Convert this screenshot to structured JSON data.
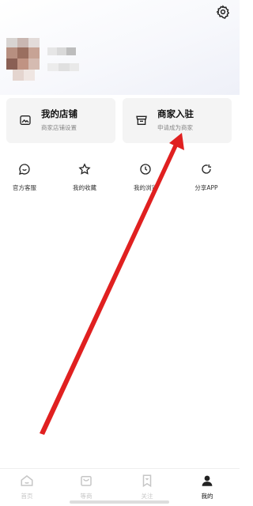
{
  "header": {
    "settings_icon": "gear-icon"
  },
  "profile": {
    "avatar_icon": "blurred-avatar",
    "name_icon": "blurred-username"
  },
  "cards": [
    {
      "title": "我的店铺",
      "subtitle": "商家店铺设置",
      "icon": "shop-photo-icon"
    },
    {
      "title": "商家入驻",
      "subtitle": "申请成为商家",
      "icon": "store-icon"
    }
  ],
  "quick_actions": [
    {
      "label": "官方客服",
      "icon": "chat-icon"
    },
    {
      "label": "我的收藏",
      "icon": "star-icon"
    },
    {
      "label": "我的浏览",
      "icon": "clock-icon"
    },
    {
      "label": "分享APP",
      "icon": "share-icon"
    }
  ],
  "tabbar": [
    {
      "label": "首页",
      "icon": "home-icon",
      "active": false
    },
    {
      "label": "等商",
      "icon": "shopping-bag-icon",
      "active": false
    },
    {
      "label": "关注",
      "icon": "bookmark-icon",
      "active": false
    },
    {
      "label": "我的",
      "icon": "user-icon",
      "active": true
    }
  ],
  "colors": {
    "accent": "#e02020",
    "card_bg": "#f4f4f4",
    "tab_inactive": "#c6c6c6",
    "tab_active": "#111111"
  }
}
